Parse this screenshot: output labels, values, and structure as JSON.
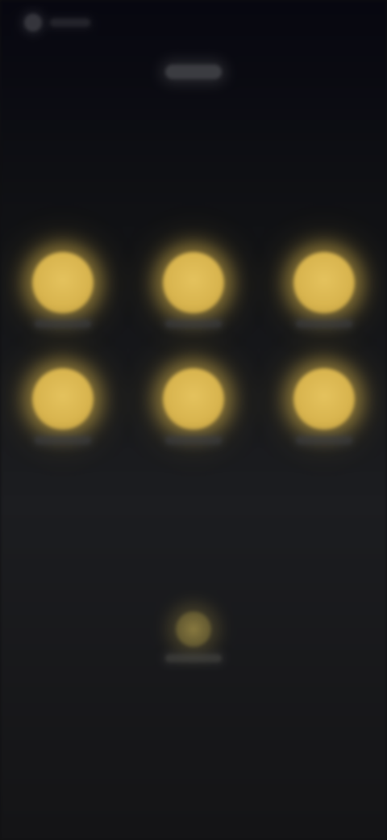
{
  "status_bar": {
    "indicator_icon": "status-indicator-icon"
  },
  "colors": {
    "background_top": "#070710",
    "background_mid": "#1c1d20",
    "accent": "#d9b54f",
    "accent_dim": "#9c8a46"
  },
  "grid": {
    "tiles": [
      {
        "icon": "circle-icon"
      },
      {
        "icon": "circle-icon"
      },
      {
        "icon": "circle-icon"
      },
      {
        "icon": "circle-icon"
      },
      {
        "icon": "circle-icon"
      },
      {
        "icon": "circle-icon"
      }
    ]
  },
  "bottom_button": {
    "icon": "circle-icon"
  }
}
